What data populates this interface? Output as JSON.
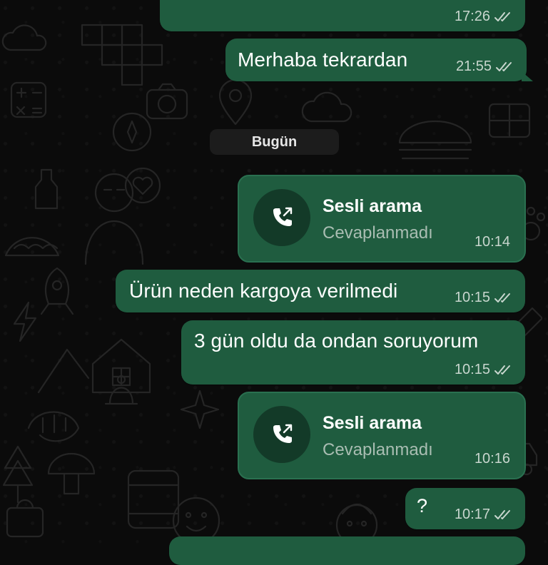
{
  "messages": [
    {
      "time": "17:26"
    },
    {
      "text": "Merhaba tekrardan",
      "time": "21:55"
    },
    {
      "text": "Ürün neden kargoya verilmedi",
      "time": "10:15"
    },
    {
      "text": "3 gün oldu da ondan soruyorum",
      "time": "10:15"
    },
    {
      "text": "?",
      "time": "10:17"
    }
  ],
  "date_separator": "Bugün",
  "calls": [
    {
      "title": "Sesli arama",
      "status": "Cevaplanmadı",
      "time": "10:14",
      "icon": "phone-outgoing-icon"
    },
    {
      "title": "Sesli arama",
      "status": "Cevaplanmadı",
      "time": "10:16",
      "icon": "phone-outgoing-icon"
    }
  ],
  "colors": {
    "background": "#0b0b0b",
    "outgoing_bubble": "#1f5c3f",
    "date_pill": "#1c1c1c",
    "call_avatar": "#133a28"
  },
  "read_receipt_icon": "double-check-icon"
}
